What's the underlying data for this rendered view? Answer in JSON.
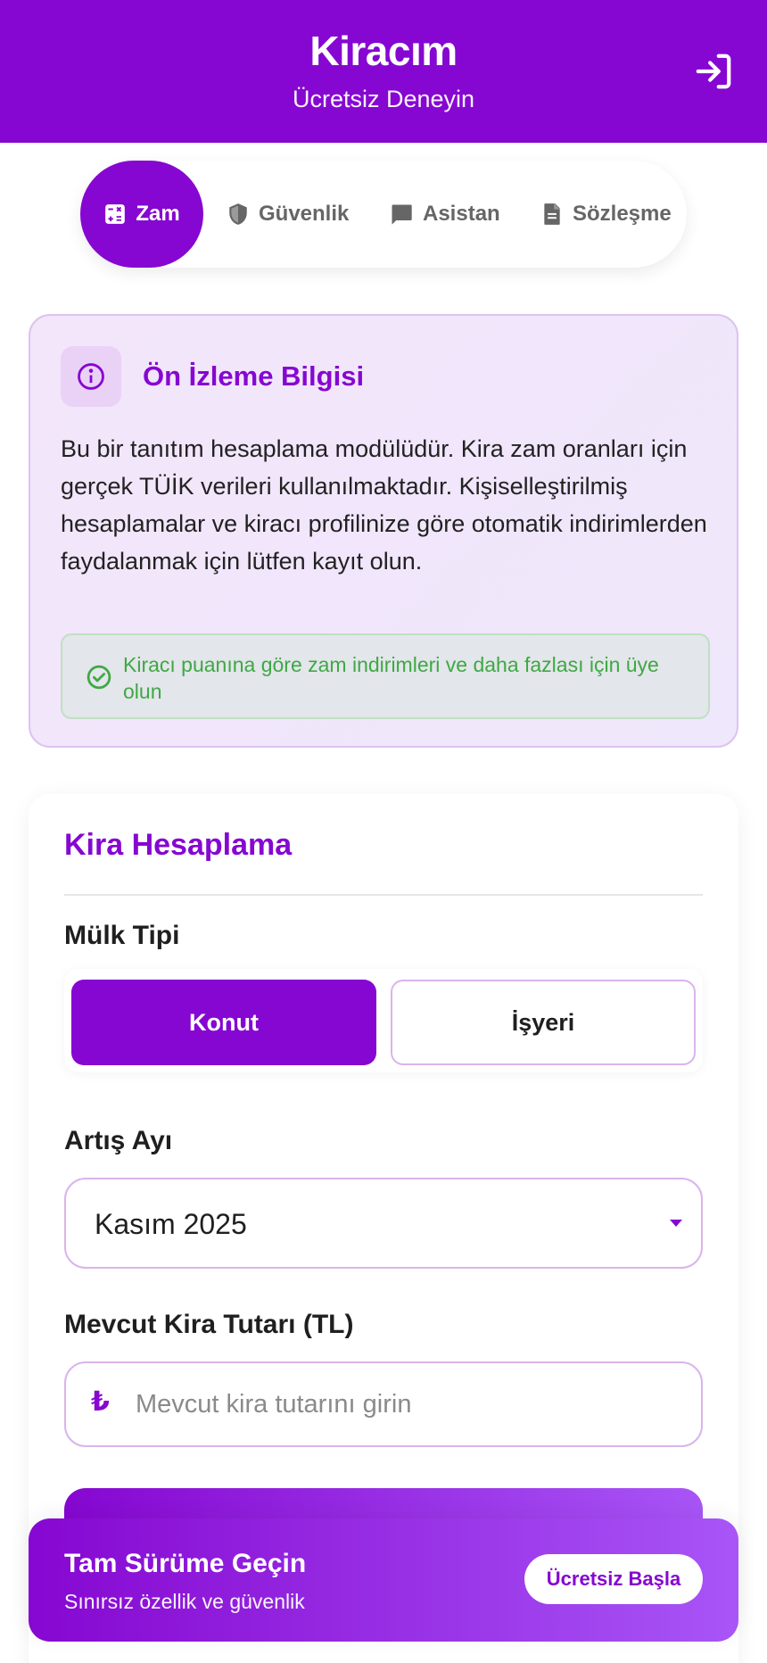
{
  "header": {
    "title": "Kiracım",
    "subtitle": "Ücretsiz Deneyin",
    "login_icon": "login-icon"
  },
  "tabs": [
    {
      "label": "Zam",
      "icon": "calculator-icon",
      "active": true
    },
    {
      "label": "Güvenlik",
      "icon": "shield-icon",
      "active": false
    },
    {
      "label": "Asistan",
      "icon": "chat-icon",
      "active": false
    },
    {
      "label": "Sözleşme",
      "icon": "document-icon",
      "active": false
    }
  ],
  "info": {
    "title": "Ön İzleme Bilgisi",
    "text": "Bu bir tanıtım hesaplama modülüdür. Kira zam oranları için gerçek TÜİK verileri kullanılmaktadır. Kişiselleştirilmiş hesaplamalar ve kiracı profilinize göre otomatik indirimlerden faydalanmak için lütfen kayıt olun.",
    "note": "Kiracı puanına göre zam indirimleri ve daha fazlası için üye olun"
  },
  "calculator": {
    "title": "Kira Hesaplama",
    "property_type_label": "Mülk Tipi",
    "property_types": [
      "Konut",
      "İşyeri"
    ],
    "selected_property_type": "Konut",
    "increase_month_label": "Artış Ayı",
    "increase_month_value": "Kasım 2025",
    "rent_label": "Mevcut Kira Tutarı (TL)",
    "rent_currency_symbol": "₺",
    "rent_placeholder": "Mevcut kira tutarını girin",
    "rent_value": ""
  },
  "promo": {
    "title": "Tam Sürüme Geçin",
    "subtitle": "Sınırsız özellik ve güvenlik",
    "button": "Ücretsiz Başla"
  },
  "colors": {
    "primary": "#8607d1",
    "accent_gradient_end": "#a855f7",
    "success": "#3fa845"
  }
}
